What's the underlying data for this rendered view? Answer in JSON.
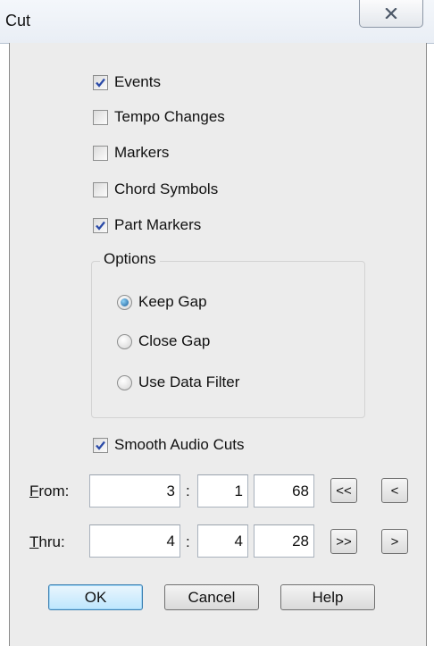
{
  "window": {
    "title": "Cut"
  },
  "checkboxes": [
    {
      "label": "Events",
      "checked": true
    },
    {
      "label": "Tempo Changes",
      "checked": false
    },
    {
      "label": "Markers",
      "checked": false
    },
    {
      "label": "Chord Symbols",
      "checked": false
    },
    {
      "label": "Part Markers",
      "checked": true
    }
  ],
  "options": {
    "legend": "Options",
    "radios": [
      {
        "label": "Keep Gap",
        "selected": true
      },
      {
        "label": "Close Gap",
        "selected": false
      },
      {
        "label": "Use Data Filter",
        "selected": false
      }
    ]
  },
  "smooth_audio": {
    "label": "Smooth Audio Cuts",
    "checked": true
  },
  "from": {
    "label": "From:",
    "accel": "F",
    "rest": "rom:",
    "bar": "3",
    "beat": "1",
    "tick": "68",
    "btn1": "<<",
    "btn2": "<"
  },
  "thru": {
    "label": "Thru:",
    "accel": "T",
    "rest": "hru:",
    "bar": "4",
    "beat": "4",
    "tick": "28",
    "btn1": ">>",
    "btn2": ">"
  },
  "separator": ":",
  "buttons": {
    "ok": "OK",
    "cancel": "Cancel",
    "help": "Help"
  },
  "icons": {
    "close": "close-icon",
    "check": "checkmark-icon"
  }
}
